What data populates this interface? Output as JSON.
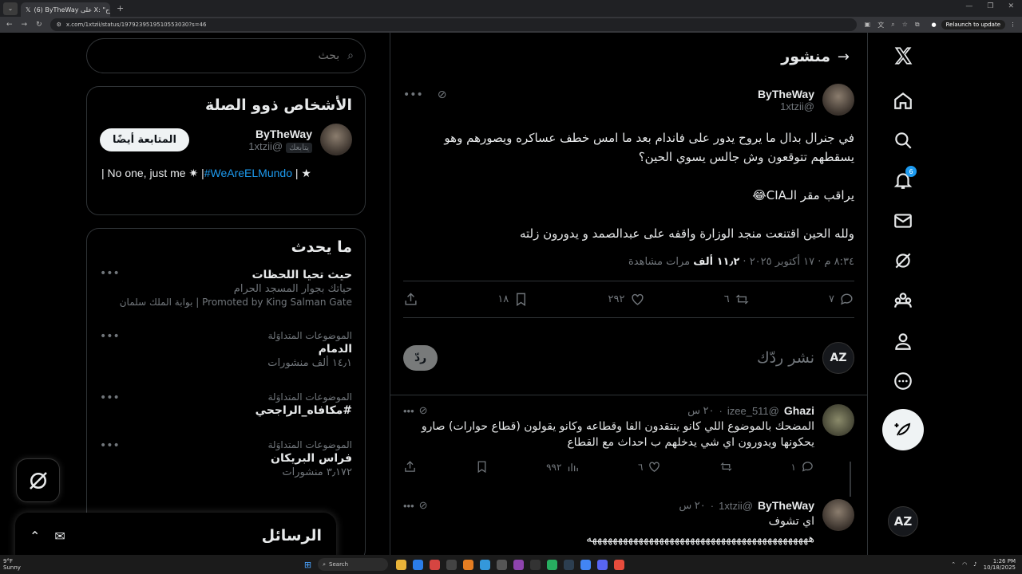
{
  "browser": {
    "tab_count_badge": "⊞",
    "tab_title": "(6) ByTheWay على X: \"في جنرال بدال ما يروح",
    "url": "x.com/1xtzii/status/1979239519510553030?s=46",
    "relaunch_label": "Relaunch to update"
  },
  "nav": {
    "notif_badge": "6"
  },
  "header": {
    "title": "منشور",
    "back": "→"
  },
  "post": {
    "display_name": "ByTheWay",
    "username": "@1xtzii",
    "paragraphs": [
      "في جنرال بدال ما يروح يدور على فاندام بعد ما امس خطف عساكره ويصورهم وهو يسقطهم  تتوقعون وش جالس يسوي الحين؟",
      "يراقب مقر الـCIA😂",
      "ولله الحين اقتنعت منجد الوزارة واقفه على عبدالصمد و يدورون زلته"
    ],
    "time": "٨:٣٤ م · ١٧ أكتوبر ٢٠٢٥ · ",
    "views": "١١٫٢ ألف",
    "views_label": " مرات مشاهدة",
    "replies": "٧",
    "reposts": "٦",
    "likes": "٢٩٢",
    "bookmarks": "١٨"
  },
  "reply_box": {
    "placeholder": "نشر ردّك",
    "button": "ردّ",
    "avatar": "AZ"
  },
  "replies": [
    {
      "display_name": "Ghazi",
      "username": "@izee_511",
      "time": "٢٠ س",
      "text": "المضحك بالموضوع اللي كانو ينتقدون الفا وقطاعه وكانو يقولون (قطاع حوارات) صارو يحكونها ويدورون اي شي يدخلهم ب احداث مع القطاع",
      "replies": "١",
      "likes": "٦",
      "views": "٩٩٢"
    },
    {
      "display_name": "ByTheWay",
      "username": "@1xtzii",
      "time": "٢٠ س",
      "text": "اي تشوف",
      "text2": "هههههههههههههههههههههههههههههههههههههههههههه"
    }
  ],
  "search": {
    "placeholder": "بحث"
  },
  "related": {
    "title": "الأشخاص ذوو الصلة",
    "display_name": "ByTheWay",
    "username": "@1xtzii",
    "follows_you": "يتابعك",
    "follow_button": "المتابعة أيضًا",
    "bio_prefix": "| No one, just me ✷ |",
    "bio_tag": "#WeAreELMundo",
    "bio_suffix": " | ★"
  },
  "trends": {
    "title": "ما يحدث",
    "items": [
      {
        "name": "حيث تحيا اللحظات",
        "sub": "حياتك بجوار المسجد الحرام",
        "promo": "Promoted by King Salman Gate | بوابة الملك سلمان"
      },
      {
        "cat": "الموضوعات المتداوَلة",
        "name": "الدمام",
        "sub": "١٤٫١ ألف منشورات"
      },
      {
        "cat": "الموضوعات المتداوَلة",
        "name": "#مكافاه_الراجحي"
      },
      {
        "cat": "الموضوعات المتداوَلة",
        "name": "فراس البريكان",
        "sub": "٣٫١٧٢ منشورات"
      }
    ]
  },
  "messages": {
    "title": "الرسائل"
  },
  "taskbar": {
    "weather_temp": "9°F",
    "weather_desc": "Sunny",
    "search_label": "Search",
    "time": "1:26 PM",
    "date": "10/18/2025"
  }
}
